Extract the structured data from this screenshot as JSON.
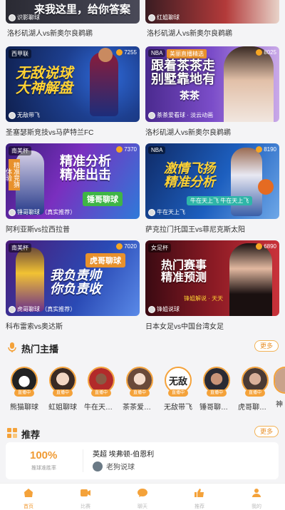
{
  "top_cards": [
    {
      "banner": "来我这里，给你答案",
      "anchor": "识影聊球",
      "caption": "洛杉矶湖人vs新奥尔良鹈鹕"
    },
    {
      "banner": "",
      "anchor": "红姐聊球",
      "caption": "洛杉矶湖人vs新奥尔良鹈鹕"
    }
  ],
  "cards": [
    {
      "tag": "西甲联",
      "views": "7255",
      "banner": "无敌说球\n大神解盘",
      "anchor": "无敌带飞",
      "caption": "圣塞瑟斯竞技vs马萨特兰FC"
    },
    {
      "tag": "NBA",
      "sub": "美丽直播精选",
      "views": "8025",
      "banner": "跟着茶茶走\n别墅靠地有",
      "banner2": "茶茶",
      "anchor": "茶茶爱看球 · 淡云动画",
      "caption": "洛杉矶湖人vs新奥尔良鹈鹕"
    },
    {
      "tag": "南美杯",
      "views": "7370",
      "banner": "精准分析\n精准出击",
      "banner2": "锤哥聊球",
      "side": "精准竞猜体验",
      "anchor": "锤哥聊球 （真实推荐）",
      "caption": "阿利亚斯vs拉西拉普"
    },
    {
      "tag": "NBA",
      "views": "8190",
      "banner": "激情飞扬\n精准分析",
      "banner2": "牛在天上飞 牛在天上飞",
      "anchor": "牛在天上飞",
      "caption": "萨克拉门托国王vs菲尼克斯太阳"
    },
    {
      "tag": "南美杯",
      "views": "7020",
      "banner": "我负责帅\n你负责收",
      "banner2": "虎哥聊球",
      "anchor": "虎哥聊球 （真实推荐）",
      "caption": "科布雷索vs奥达斯"
    },
    {
      "tag": "女足杯",
      "views": "6890",
      "banner": "热门赛事\n精准预测",
      "banner2": "锋姐解说 · 天天",
      "anchor": "锋姐说球",
      "caption": "日本女足vs中国台湾女足"
    }
  ],
  "hot_section": {
    "title": "热门主播",
    "more": "更多"
  },
  "hot_anchors": [
    {
      "name": "熊猫聊球",
      "live": "直播中"
    },
    {
      "name": "虹姐聊球",
      "live": "直播中"
    },
    {
      "name": "牛在天上飞",
      "live": "直播中"
    },
    {
      "name": "茶茶爱看球",
      "live": "直播中"
    },
    {
      "name": "无敌带飞",
      "live": "直播中",
      "avatar_text": "无敌"
    },
    {
      "name": "锤哥聊球…",
      "live": "直播中"
    },
    {
      "name": "虎哥聊球…",
      "live": "直播中"
    },
    {
      "name": "神",
      "live": ""
    }
  ],
  "rec_section": {
    "title": "推荐",
    "more": "更多"
  },
  "rec_card": {
    "percent": "100%",
    "percent_label": "推球准胜率",
    "match": "英超 埃弗顿-伯恩利",
    "expert": "老狗说球"
  },
  "tabs": [
    {
      "label": "首页",
      "active": true
    },
    {
      "label": "比赛",
      "active": false
    },
    {
      "label": "聊天",
      "active": false
    },
    {
      "label": "推荐",
      "active": false
    },
    {
      "label": "我的",
      "active": false
    }
  ],
  "colors": {
    "accent": "#f09a33",
    "background": "#f4f4f6"
  }
}
